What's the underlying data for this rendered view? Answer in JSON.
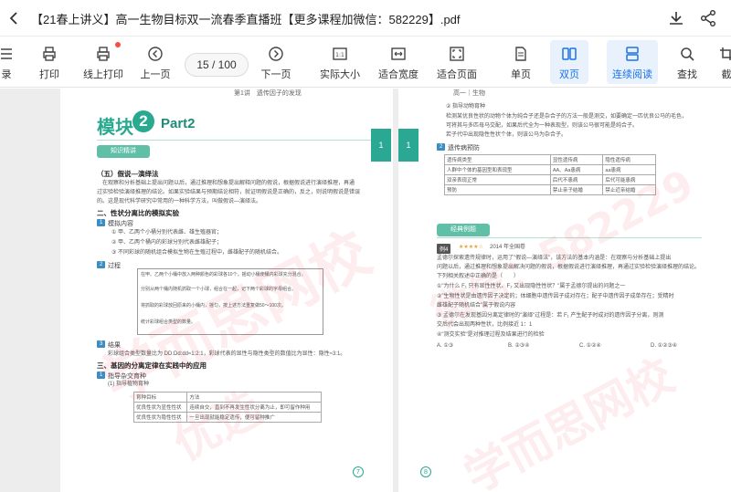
{
  "window": {
    "title": "【21春上讲义】高一生物目标双一流春季直播班【更多课程加微信：582229】.pdf"
  },
  "toolbar": {
    "items": [
      {
        "label": "录",
        "icon": "list-icon"
      },
      {
        "label": "打印",
        "icon": "printer-icon"
      },
      {
        "label": "线上打印",
        "icon": "online-print-icon"
      },
      {
        "label": "上一页",
        "icon": "previous-page-icon"
      },
      {
        "label": "下一页",
        "icon": "next-page-icon"
      },
      {
        "label": "实际大小",
        "icon": "actual-size-icon"
      },
      {
        "label": "适合宽度",
        "icon": "fit-width-icon"
      },
      {
        "label": "适合页面",
        "icon": "fit-page-icon"
      },
      {
        "label": "单页",
        "icon": "single-page-icon"
      },
      {
        "label": "双页",
        "icon": "double-page-icon"
      },
      {
        "label": "连续阅读",
        "icon": "continuous-read-icon"
      },
      {
        "label": "查找",
        "icon": "search-icon"
      },
      {
        "label": "截",
        "icon": "screenshot-icon"
      }
    ],
    "page_indicator": "15 / 100",
    "accent_color": "#1a73e8",
    "notification_dot_color": "#f5503c"
  },
  "document": {
    "left_page": {
      "header": "第1讲　遗传因子的发现",
      "module_title": "模块",
      "module_number": "2",
      "module_part": "Part2",
      "banner": "知识精讲",
      "side_tab": "1",
      "section_heading": "（五）假说—演绎法",
      "para1": "在观察和分析基础上提出问题以后，通过推理和想象提出解释问题的假说，根据假说进行演绎推理，再通",
      "para2": "过实验检验演绎推理的结论。如果实验结果与预期结论相符，就证明假说是正确的，反之，则说明假说是错误",
      "para3": "的。这是现代科学研究中常用的一种科学方法，叫做假说—演绎法。",
      "h2": "二、性状分离比的模拟实验",
      "tag1": "1",
      "sub1": "模拟内容",
      "item1": "① 甲、乙两个小桶分别代表雌、雄生殖器官；",
      "item2": "② 甲、乙两个桶内的彩球分别代表雌雄配子；",
      "item3": "③ 不同彩球的随机组合模拟生物在生殖过程中，雌雄配子的随机结合。",
      "tag2": "2",
      "sub2": "过程",
      "box1": "在甲、乙两个小桶中放入两种颜色的彩球各10个，摇动小桶使桶内彩球充分混合。",
      "box2": "分别从两个桶内随机抓取一个小球，组合在一起，记下两个彩球的字母组合。",
      "box3": "将抓取的彩球放回原来的小桶内，摇匀，按上述方法重复做50～100次。",
      "box4": "统计彩球组合类型的数量。",
      "tag3": "3",
      "sub3": "结果",
      "result": "彩球组合类型数量比为 DD:Dd:dd≈1:2:1，彩球代表的显性与隐性类型的数值比为显性：隐性≈3:1。",
      "h3": "三、基因的分离定律在实践中的应用",
      "tag4": "1",
      "sub4": "指导杂交育种",
      "sub5": "(1) 指导植物育种",
      "table": [
        [
          "育种目标",
          "方法"
        ],
        [
          "优良性状为显性性状",
          "连续自交，直到不再发生性状分离为止，即可留作种用"
        ],
        [
          "优良性状为隐性性状",
          "一旦出现就能稳定遗传，便可留种推广"
        ]
      ],
      "page_number": "7"
    },
    "right_page": {
      "header": "高一｜生物",
      "line1": "② 指导动物育种",
      "line2": "检测某优良性状的动物个体为纯合子还是杂合子的方法一般是测交，如要确定一匹优良公马的毛色，",
      "line3": "可将其与多匹母马交配，如果后代全为一种表现型，则该公马很可能是纯合子。",
      "line4": "若子代中出现隐性性状个体，则该公马为杂合子。",
      "tag1": "2",
      "sub1": "遗传病预防",
      "table": [
        [
          "遗传病类型",
          "显性遗传病",
          "隐性遗传病"
        ],
        [
          "人群中个体的基因型和表现型",
          "AA、Aa患病",
          "aa患病"
        ],
        [
          "双亲表现正常",
          "后代不患病",
          "后代可能患病"
        ],
        [
          "预防",
          "禁止亲子结婚",
          "禁止近亲结婚"
        ]
      ],
      "side_tab": "1",
      "banner": "经典例题",
      "example_label": "例4",
      "example_stars": "★★★★☆",
      "example_source": "2014 年全国卷",
      "q1": "孟德尔探索遗传规律时，运用了\"假说—演绎法\"，该方法的基本内涵是：在观察与分析基础上提出",
      "q2": "问题以后，通过推理和想象提出解决问题的假说，根据假说进行演绎推理，再通过实验检验演绎推理的结论。",
      "q3": "下列相关叙述中正确的是（　　）",
      "o1": "①\"为什么 F₁ 只有显性性状、F₂ 又出现隐性性状？\"属于孟德尔提出的问题之一",
      "o2": "②\"生物性状是由遗传因子决定的；体细胞中遗传因子成对存在；配子中遗传因子成单存在；受精时",
      "o3": "雌雄配子随机结合\"属于假说内容",
      "o4": "③ 孟德尔在发现基因分离定律时的\"演绎\"过程是：若 F₁ 产生配子时成对的遗传因子分离，则测",
      "o5": "交后代会出现两种性状，比例接近 1：1",
      "o6": "④\"测交实验\"是对推理过程及结果进行的检验",
      "choices": [
        "A. ①③",
        "B. ②③④",
        "C. ①②④",
        "D. ①②③④"
      ],
      "page_number": "8"
    },
    "watermarks": [
      "学而思网校",
      "微信：582229",
      "学而思网校",
      "优选"
    ]
  }
}
